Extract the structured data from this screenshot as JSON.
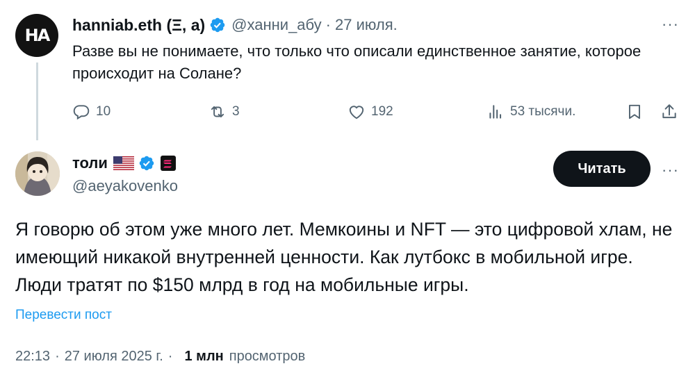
{
  "parent_tweet": {
    "avatar_text": "HA",
    "author_name": "hanniab.eth (Ξ, a)",
    "handle": "@ханни_абу",
    "separator": "·",
    "date": "27 июля.",
    "more": "···",
    "text": "Разве вы не понимаете, что только что описали единственное занятие, которое происходит на Солане?",
    "actions": {
      "replies": "10",
      "retweets": "3",
      "likes": "192",
      "views": "53 тысячи."
    }
  },
  "main_tweet": {
    "author_name": "толи",
    "handle": "@aeyakovenko",
    "more": "···",
    "read_button": "Читать",
    "text": "Я говорю об этом уже много лет. Мемкоины и NFT — это цифровой хлам, не имеющий никакой внутренней ценности. Как лутбокс в мобильной игре. Люди тратят по $150 млрд в год на мобильные игры.",
    "translate_link": "Перевести пост",
    "time": "22:13",
    "separator": "·",
    "date": "27 июля 2025 г.",
    "separator2": "·",
    "views_count": "1 млн",
    "views_label": "просмотров"
  },
  "colors": {
    "text_primary": "#0f1419",
    "text_secondary": "#536471",
    "accent_blue": "#1d9bf0",
    "button_bg": "#0f1419",
    "thread_line": "#cfd9de"
  },
  "icons": [
    "reply-icon",
    "retweet-icon",
    "like-icon",
    "views-icon",
    "bookmark-icon",
    "share-icon",
    "verified-badge-icon",
    "us-flag-icon",
    "solana-badge-icon"
  ]
}
